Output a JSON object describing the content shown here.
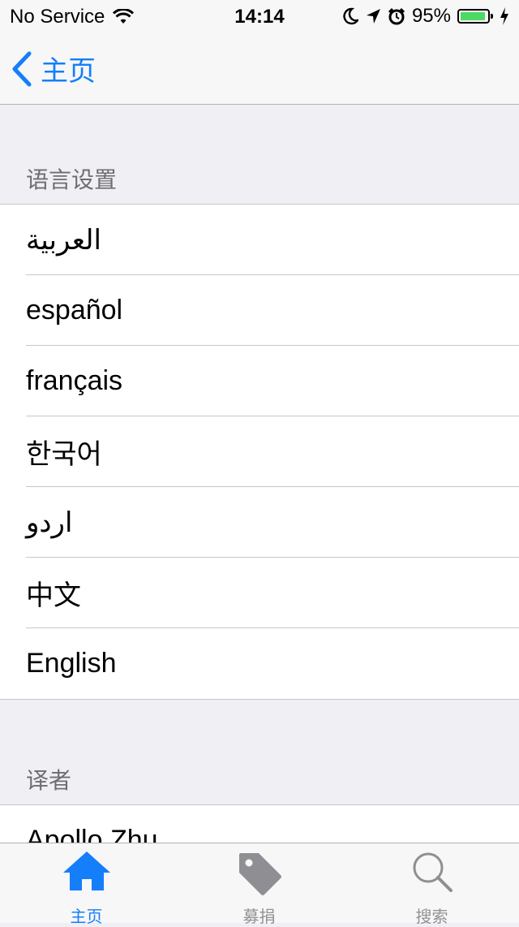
{
  "status_bar": {
    "carrier": "No Service",
    "time": "14:14",
    "battery_percent": "95%",
    "battery_level": 0.95
  },
  "nav": {
    "back_label": "主页"
  },
  "sections": [
    {
      "header": "语言设置",
      "items": [
        "العربية",
        "español",
        "français",
        "한국어",
        "اردو",
        "中文",
        "English"
      ]
    },
    {
      "header": "译者",
      "items": [
        "Apollo Zhu"
      ]
    }
  ],
  "tabbar": {
    "tabs": [
      {
        "label": "主页",
        "icon": "home-icon",
        "active": true
      },
      {
        "label": "募捐",
        "icon": "tag-icon",
        "active": false
      },
      {
        "label": "搜索",
        "icon": "search-icon",
        "active": false
      }
    ]
  },
  "colors": {
    "accent": "#157efb",
    "battery": "#4cd964",
    "inactive_tab": "#929292",
    "background": "#efeff4"
  }
}
